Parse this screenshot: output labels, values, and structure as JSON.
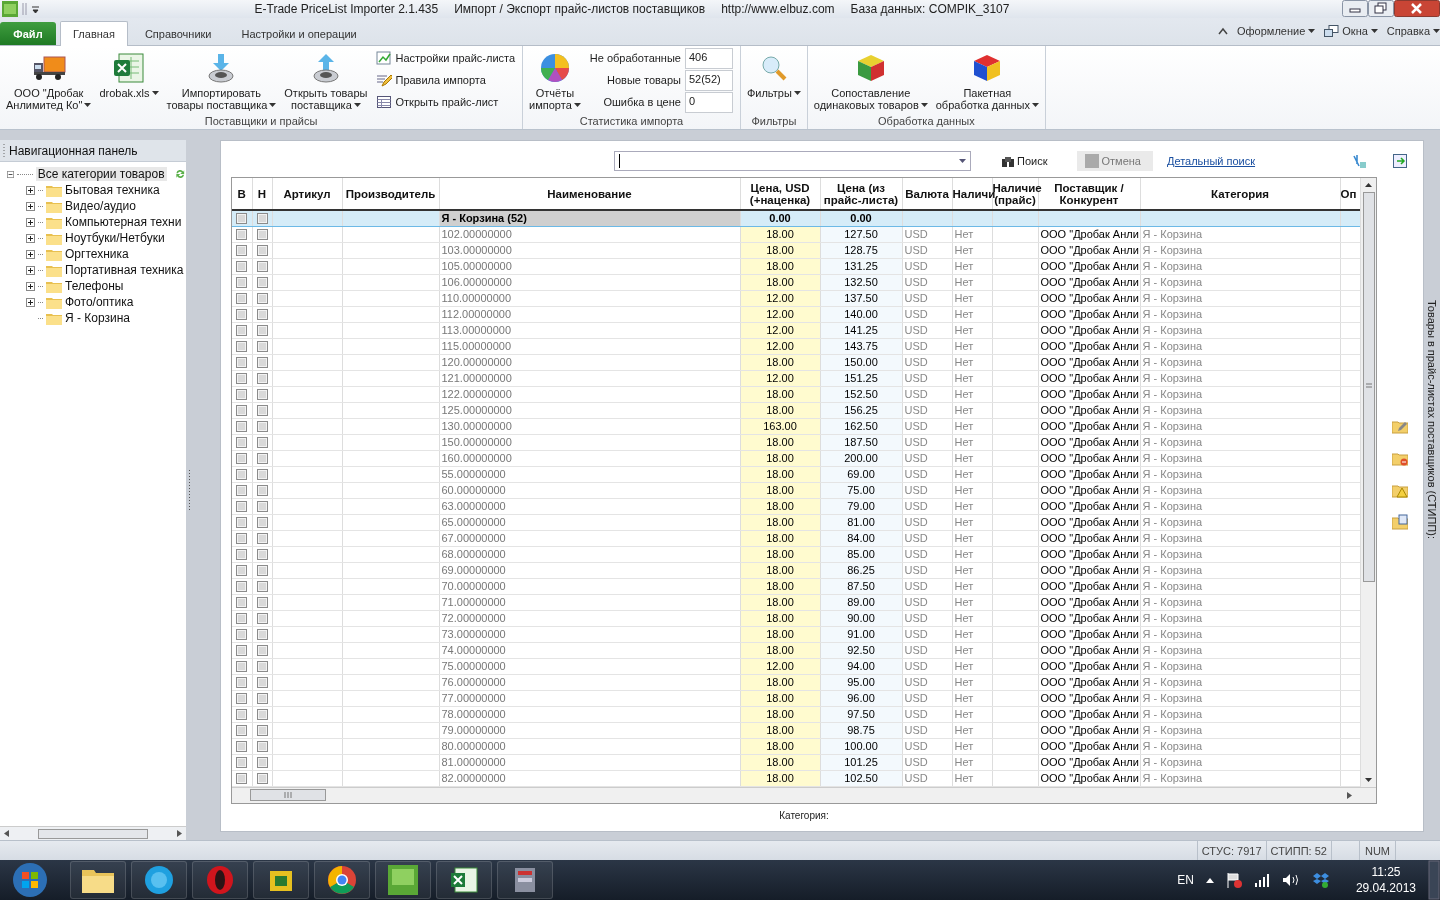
{
  "window": {
    "title_parts": [
      "E-Trade PriceList Importer 2.1.435",
      "Импорт / Экспорт прайс-листов поставщиков",
      "http://www.elbuz.com",
      "База данных: COMPIK_3107"
    ]
  },
  "tabs": [
    {
      "label": "Файл",
      "kind": "file",
      "selected": false
    },
    {
      "label": "Главная",
      "kind": "tab",
      "selected": true
    },
    {
      "label": "Справочники",
      "kind": "tab",
      "selected": false
    },
    {
      "label": "Настройки и операции",
      "kind": "tab",
      "selected": false
    }
  ],
  "menu_right": [
    {
      "label": "Оформление",
      "dropdown": true
    },
    {
      "label": "Окна",
      "dropdown": true
    },
    {
      "label": "Справка",
      "dropdown": true
    }
  ],
  "ribbon": [
    {
      "title": "Поставщики и прайсы",
      "items": [
        {
          "kind": "big",
          "label": "ООО \"Дробак\nАнлимитед Ко\"",
          "dropdown": true
        },
        {
          "kind": "big",
          "label": "drobak.xls",
          "dropdown": true
        },
        {
          "kind": "big",
          "label": "Импортировать\nтовары поставщика",
          "dropdown": true
        },
        {
          "kind": "big",
          "label": "Открыть товары\nпоставщика",
          "dropdown": true
        },
        {
          "kind": "small",
          "label": "Настройки прайс-листа"
        },
        {
          "kind": "small",
          "label": "Правила импорта"
        },
        {
          "kind": "small",
          "label": "Открыть прайс-лист"
        }
      ]
    },
    {
      "title": "Статистика импорта",
      "items": [
        {
          "kind": "big",
          "label": "Отчёты\nимпорта",
          "dropdown": true
        },
        {
          "kind": "stat",
          "label": "Не обработанные",
          "value": "406"
        },
        {
          "kind": "stat",
          "label": "Новые товары",
          "value": "52(52)"
        },
        {
          "kind": "stat",
          "label": "Ошибка в цене",
          "value": "0"
        }
      ]
    },
    {
      "title": "Фильтры",
      "items": [
        {
          "kind": "big",
          "label": "Фильтры",
          "dropdown": true
        }
      ]
    },
    {
      "title": "Обработка данных",
      "items": [
        {
          "kind": "big",
          "label": "Сопоставление\nодинаковых товаров",
          "dropdown": true
        },
        {
          "kind": "big",
          "label": "Пакетная\nобработка данных",
          "dropdown": true
        }
      ]
    }
  ],
  "nav": {
    "title": "Навигационная панель",
    "tree": {
      "label": "Все категории товаров",
      "expanded": true,
      "selected": true,
      "children": [
        {
          "label": "Бытовая техника",
          "kind": "group",
          "expanded": false
        },
        {
          "label": "Видео/аудио",
          "kind": "group",
          "expanded": false
        },
        {
          "label": "Компьютерная техни",
          "kind": "group",
          "expanded": false
        },
        {
          "label": "Ноутбуки/Нетбуки",
          "kind": "group",
          "expanded": false
        },
        {
          "label": "Оргтехника",
          "kind": "group",
          "expanded": false
        },
        {
          "label": "Портативная техника",
          "kind": "group",
          "expanded": false
        },
        {
          "label": "Телефоны",
          "kind": "group",
          "expanded": false
        },
        {
          "label": "Фото/оптика",
          "kind": "group",
          "expanded": false
        },
        {
          "label": "Я - Корзина",
          "kind": "leaf"
        }
      ]
    }
  },
  "search": {
    "search_button": "Поиск",
    "cancel_button": "Отмена",
    "cancel_disabled": true,
    "detail_link": "Детальный поиск"
  },
  "grid": {
    "columns": [
      "В",
      "Н",
      "Артикул",
      "Производитель",
      "Наименование",
      "Цена, USD (+наценка)",
      "Цена (из прайс-листа)",
      "Валюта",
      "Наличи",
      "Наличие (прайс)",
      "Поставщик / Конкурент",
      "Категория",
      "Оп"
    ],
    "group_row": {
      "label": "Я - Корзина (52)",
      "price": "0.00",
      "list_price": "0.00",
      "b": false,
      "h": false,
      "selected": true
    },
    "rows": [
      {
        "name": "102.00000000",
        "price": "18.00",
        "list_price": "127.50",
        "currency": "USD",
        "stock": "Нет",
        "supplier": "ООО \"Дробак Анли",
        "category": "Я - Корзина",
        "b": false,
        "h": false,
        "selected": false
      },
      {
        "name": "103.00000000",
        "price": "18.00",
        "list_price": "128.75",
        "currency": "USD",
        "stock": "Нет",
        "supplier": "ООО \"Дробак Анли",
        "category": "Я - Корзина",
        "b": false,
        "h": false,
        "selected": false
      },
      {
        "name": "105.00000000",
        "price": "18.00",
        "list_price": "131.25",
        "currency": "USD",
        "stock": "Нет",
        "supplier": "ООО \"Дробак Анли",
        "category": "Я - Корзина",
        "b": false,
        "h": false,
        "selected": false
      },
      {
        "name": "106.00000000",
        "price": "18.00",
        "list_price": "132.50",
        "currency": "USD",
        "stock": "Нет",
        "supplier": "ООО \"Дробак Анли",
        "category": "Я - Корзина",
        "b": false,
        "h": false,
        "selected": false
      },
      {
        "name": "110.00000000",
        "price": "12.00",
        "list_price": "137.50",
        "currency": "USD",
        "stock": "Нет",
        "supplier": "ООО \"Дробак Анли",
        "category": "Я - Корзина",
        "b": false,
        "h": false,
        "selected": false
      },
      {
        "name": "112.00000000",
        "price": "12.00",
        "list_price": "140.00",
        "currency": "USD",
        "stock": "Нет",
        "supplier": "ООО \"Дробак Анли",
        "category": "Я - Корзина",
        "b": false,
        "h": false,
        "selected": false
      },
      {
        "name": "113.00000000",
        "price": "12.00",
        "list_price": "141.25",
        "currency": "USD",
        "stock": "Нет",
        "supplier": "ООО \"Дробак Анли",
        "category": "Я - Корзина",
        "b": false,
        "h": false,
        "selected": false
      },
      {
        "name": "115.00000000",
        "price": "12.00",
        "list_price": "143.75",
        "currency": "USD",
        "stock": "Нет",
        "supplier": "ООО \"Дробак Анли",
        "category": "Я - Корзина",
        "b": false,
        "h": false,
        "selected": false
      },
      {
        "name": "120.00000000",
        "price": "18.00",
        "list_price": "150.00",
        "currency": "USD",
        "stock": "Нет",
        "supplier": "ООО \"Дробак Анли",
        "category": "Я - Корзина",
        "b": false,
        "h": false,
        "selected": false
      },
      {
        "name": "121.00000000",
        "price": "12.00",
        "list_price": "151.25",
        "currency": "USD",
        "stock": "Нет",
        "supplier": "ООО \"Дробак Анли",
        "category": "Я - Корзина",
        "b": false,
        "h": false,
        "selected": false
      },
      {
        "name": "122.00000000",
        "price": "18.00",
        "list_price": "152.50",
        "currency": "USD",
        "stock": "Нет",
        "supplier": "ООО \"Дробак Анли",
        "category": "Я - Корзина",
        "b": false,
        "h": false,
        "selected": false
      },
      {
        "name": "125.00000000",
        "price": "18.00",
        "list_price": "156.25",
        "currency": "USD",
        "stock": "Нет",
        "supplier": "ООО \"Дробак Анли",
        "category": "Я - Корзина",
        "b": false,
        "h": false,
        "selected": false
      },
      {
        "name": "130.00000000",
        "price": "163.00",
        "list_price": "162.50",
        "currency": "USD",
        "stock": "Нет",
        "supplier": "ООО \"Дробак Анли",
        "category": "Я - Корзина",
        "b": false,
        "h": false,
        "selected": false
      },
      {
        "name": "150.00000000",
        "price": "18.00",
        "list_price": "187.50",
        "currency": "USD",
        "stock": "Нет",
        "supplier": "ООО \"Дробак Анли",
        "category": "Я - Корзина",
        "b": false,
        "h": false,
        "selected": false
      },
      {
        "name": "160.00000000",
        "price": "18.00",
        "list_price": "200.00",
        "currency": "USD",
        "stock": "Нет",
        "supplier": "ООО \"Дробак Анли",
        "category": "Я - Корзина",
        "b": false,
        "h": false,
        "selected": false
      },
      {
        "name": "55.00000000",
        "price": "18.00",
        "list_price": "69.00",
        "currency": "USD",
        "stock": "Нет",
        "supplier": "ООО \"Дробак Анли",
        "category": "Я - Корзина",
        "b": false,
        "h": false,
        "selected": false
      },
      {
        "name": "60.00000000",
        "price": "18.00",
        "list_price": "75.00",
        "currency": "USD",
        "stock": "Нет",
        "supplier": "ООО \"Дробак Анли",
        "category": "Я - Корзина",
        "b": false,
        "h": false,
        "selected": false
      },
      {
        "name": "63.00000000",
        "price": "18.00",
        "list_price": "79.00",
        "currency": "USD",
        "stock": "Нет",
        "supplier": "ООО \"Дробак Анли",
        "category": "Я - Корзина",
        "b": false,
        "h": false,
        "selected": false
      },
      {
        "name": "65.00000000",
        "price": "18.00",
        "list_price": "81.00",
        "currency": "USD",
        "stock": "Нет",
        "supplier": "ООО \"Дробак Анли",
        "category": "Я - Корзина",
        "b": false,
        "h": false,
        "selected": false
      },
      {
        "name": "67.00000000",
        "price": "18.00",
        "list_price": "84.00",
        "currency": "USD",
        "stock": "Нет",
        "supplier": "ООО \"Дробак Анли",
        "category": "Я - Корзина",
        "b": false,
        "h": false,
        "selected": false
      },
      {
        "name": "68.00000000",
        "price": "18.00",
        "list_price": "85.00",
        "currency": "USD",
        "stock": "Нет",
        "supplier": "ООО \"Дробак Анли",
        "category": "Я - Корзина",
        "b": false,
        "h": false,
        "selected": false
      },
      {
        "name": "69.00000000",
        "price": "18.00",
        "list_price": "86.25",
        "currency": "USD",
        "stock": "Нет",
        "supplier": "ООО \"Дробак Анли",
        "category": "Я - Корзина",
        "b": false,
        "h": false,
        "selected": false
      },
      {
        "name": "70.00000000",
        "price": "18.00",
        "list_price": "87.50",
        "currency": "USD",
        "stock": "Нет",
        "supplier": "ООО \"Дробак Анли",
        "category": "Я - Корзина",
        "b": false,
        "h": false,
        "selected": false
      },
      {
        "name": "71.00000000",
        "price": "18.00",
        "list_price": "89.00",
        "currency": "USD",
        "stock": "Нет",
        "supplier": "ООО \"Дробак Анли",
        "category": "Я - Корзина",
        "b": false,
        "h": false,
        "selected": false
      },
      {
        "name": "72.00000000",
        "price": "18.00",
        "list_price": "90.00",
        "currency": "USD",
        "stock": "Нет",
        "supplier": "ООО \"Дробак Анли",
        "category": "Я - Корзина",
        "b": false,
        "h": false,
        "selected": false
      },
      {
        "name": "73.00000000",
        "price": "18.00",
        "list_price": "91.00",
        "currency": "USD",
        "stock": "Нет",
        "supplier": "ООО \"Дробак Анли",
        "category": "Я - Корзина",
        "b": false,
        "h": false,
        "selected": false
      },
      {
        "name": "74.00000000",
        "price": "18.00",
        "list_price": "92.50",
        "currency": "USD",
        "stock": "Нет",
        "supplier": "ООО \"Дробак Анли",
        "category": "Я - Корзина",
        "b": false,
        "h": false,
        "selected": false
      },
      {
        "name": "75.00000000",
        "price": "12.00",
        "list_price": "94.00",
        "currency": "USD",
        "stock": "Нет",
        "supplier": "ООО \"Дробак Анли",
        "category": "Я - Корзина",
        "b": false,
        "h": false,
        "selected": false
      },
      {
        "name": "76.00000000",
        "price": "18.00",
        "list_price": "95.00",
        "currency": "USD",
        "stock": "Нет",
        "supplier": "ООО \"Дробак Анли",
        "category": "Я - Корзина",
        "b": false,
        "h": false,
        "selected": false
      },
      {
        "name": "77.00000000",
        "price": "18.00",
        "list_price": "96.00",
        "currency": "USD",
        "stock": "Нет",
        "supplier": "ООО \"Дробак Анли",
        "category": "Я - Корзина",
        "b": false,
        "h": false,
        "selected": false
      },
      {
        "name": "78.00000000",
        "price": "18.00",
        "list_price": "97.50",
        "currency": "USD",
        "stock": "Нет",
        "supplier": "ООО \"Дробак Анли",
        "category": "Я - Корзина",
        "b": false,
        "h": false,
        "selected": false
      },
      {
        "name": "79.00000000",
        "price": "18.00",
        "list_price": "98.75",
        "currency": "USD",
        "stock": "Нет",
        "supplier": "ООО \"Дробак Анли",
        "category": "Я - Корзина",
        "b": false,
        "h": false,
        "selected": false
      },
      {
        "name": "80.00000000",
        "price": "18.00",
        "list_price": "100.00",
        "currency": "USD",
        "stock": "Нет",
        "supplier": "ООО \"Дробак Анли",
        "category": "Я - Корзина",
        "b": false,
        "h": false,
        "selected": false
      },
      {
        "name": "81.00000000",
        "price": "18.00",
        "list_price": "101.25",
        "currency": "USD",
        "stock": "Нет",
        "supplier": "ООО \"Дробак Анли",
        "category": "Я - Корзина",
        "b": false,
        "h": false,
        "selected": false
      },
      {
        "name": "82.00000000",
        "price": "18.00",
        "list_price": "102.50",
        "currency": "USD",
        "stock": "Нет",
        "supplier": "ООО \"Дробак Анли",
        "category": "Я - Корзина",
        "b": false,
        "h": false,
        "selected": false
      }
    ]
  },
  "category_label": "Категория:",
  "side_tab": "Товары в прайс-листах поставщиков (СТИПП):",
  "status_bar": [
    "СТУС: 7917",
    "СТИПП: 52",
    "NUM"
  ],
  "taskbar": {
    "language": "EN",
    "time": "11:25",
    "date": "29.04.2013"
  }
}
